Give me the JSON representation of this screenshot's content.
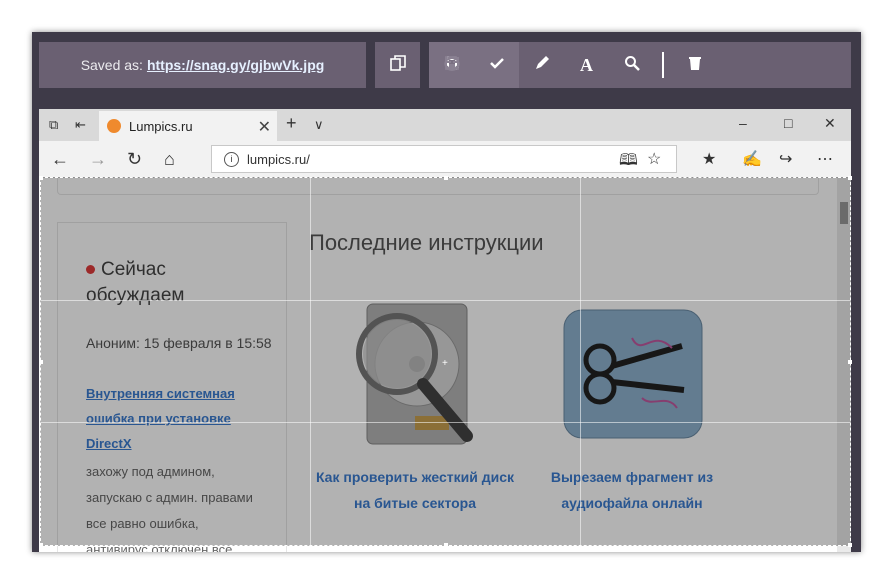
{
  "toolbar": {
    "saved_prefix": "Saved as:",
    "saved_link": "https://snag.gy/gjbwVk.jpg",
    "icons": [
      "copy-icon",
      "crop-icon",
      "check-icon",
      "pencil-icon",
      "text-icon",
      "zoom-icon",
      "undo-icon",
      "redo-icon",
      "save-icon",
      "trash-icon"
    ]
  },
  "browser": {
    "tab_title": "Lumpics.ru",
    "url": "lumpics.ru/"
  },
  "page": {
    "sidebar_title": "Сейчас обсуждаем",
    "comment_meta": "Аноним: 15 февраля в 15:58",
    "comment_link": "Внутренняя системная ошибка при установке DirectX",
    "comment_text_1": "захожу под админом,",
    "comment_text_2": "запускаю с админ. правами",
    "comment_text_3": "все равно ошибка,",
    "comment_text_4": "антивирус отключен все",
    "heading": "Последние инструкции",
    "card1_title": "Как проверить жесткий диск на битые сектора",
    "card2_title": "Вырезаем фрагмент из аудиофайла онлайн"
  }
}
